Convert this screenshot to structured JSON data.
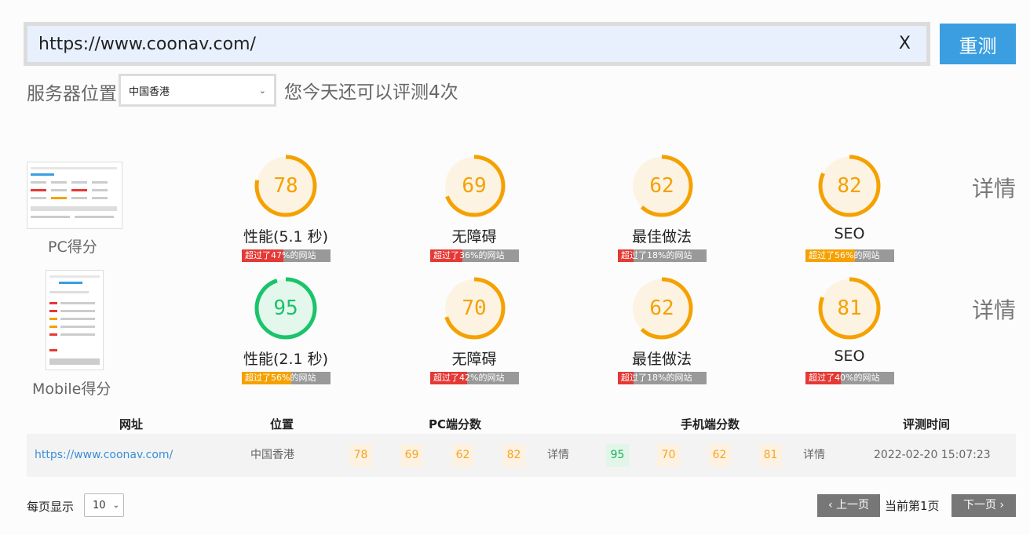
{
  "search": {
    "url_value": "https://www.coonav.com/",
    "clear_label": "X",
    "retest_label": "重测"
  },
  "location": {
    "label": "服务器位置",
    "selected": "中国香港",
    "remaining_text": "您今天还可以评测4次"
  },
  "pc": {
    "label": "PC得分",
    "detail_label": "详情",
    "metrics": [
      {
        "score": "78",
        "value": 78,
        "name": "性能(5.1 秒)",
        "exceed_text": "超过了47%的网站",
        "exceed_pct": 47,
        "color": "#f5a100",
        "bar_color": "#e53935"
      },
      {
        "score": "69",
        "value": 69,
        "name": "无障碍",
        "exceed_text": "超过了36%的网站",
        "exceed_pct": 36,
        "color": "#f5a100",
        "bar_color": "#e53935"
      },
      {
        "score": "62",
        "value": 62,
        "name": "最佳做法",
        "exceed_text": "超过了18%的网站",
        "exceed_pct": 18,
        "color": "#f5a100",
        "bar_color": "#e53935"
      },
      {
        "score": "82",
        "value": 82,
        "name": "SEO",
        "exceed_text": "超过了56%的网站",
        "exceed_pct": 56,
        "color": "#f5a100",
        "bar_color": "#f5a100"
      }
    ]
  },
  "mobile": {
    "label": "Mobile得分",
    "detail_label": "详情",
    "metrics": [
      {
        "score": "95",
        "value": 95,
        "name": "性能(2.1 秒)",
        "exceed_text": "超过了56%的网站",
        "exceed_pct": 56,
        "color": "#19c46a",
        "bar_color": "#f5a100"
      },
      {
        "score": "70",
        "value": 70,
        "name": "无障碍",
        "exceed_text": "超过了42%的网站",
        "exceed_pct": 42,
        "color": "#f5a100",
        "bar_color": "#e53935"
      },
      {
        "score": "62",
        "value": 62,
        "name": "最佳做法",
        "exceed_text": "超过了18%的网站",
        "exceed_pct": 18,
        "color": "#f5a100",
        "bar_color": "#e53935"
      },
      {
        "score": "81",
        "value": 81,
        "name": "SEO",
        "exceed_text": "超过了40%的网站",
        "exceed_pct": 40,
        "color": "#f5a100",
        "bar_color": "#e53935"
      }
    ]
  },
  "table": {
    "headers": [
      "网址",
      "位置",
      "PC端分数",
      "手机端分数",
      "评测时间"
    ],
    "row": {
      "url": "https://www.coonav.com/",
      "location": "中国香港",
      "pc_scores": [
        "78",
        "69",
        "62",
        "82"
      ],
      "pc_detail": "详情",
      "mobile_scores": [
        "95",
        "70",
        "62",
        "81"
      ],
      "mobile_detail": "详情",
      "time": "2022-02-20 15:07:23"
    }
  },
  "pagination": {
    "per_page_label": "每页显示",
    "per_page_value": "10",
    "prev_label": "上一页",
    "current_label": "当前第1页",
    "next_label": "下一页"
  }
}
